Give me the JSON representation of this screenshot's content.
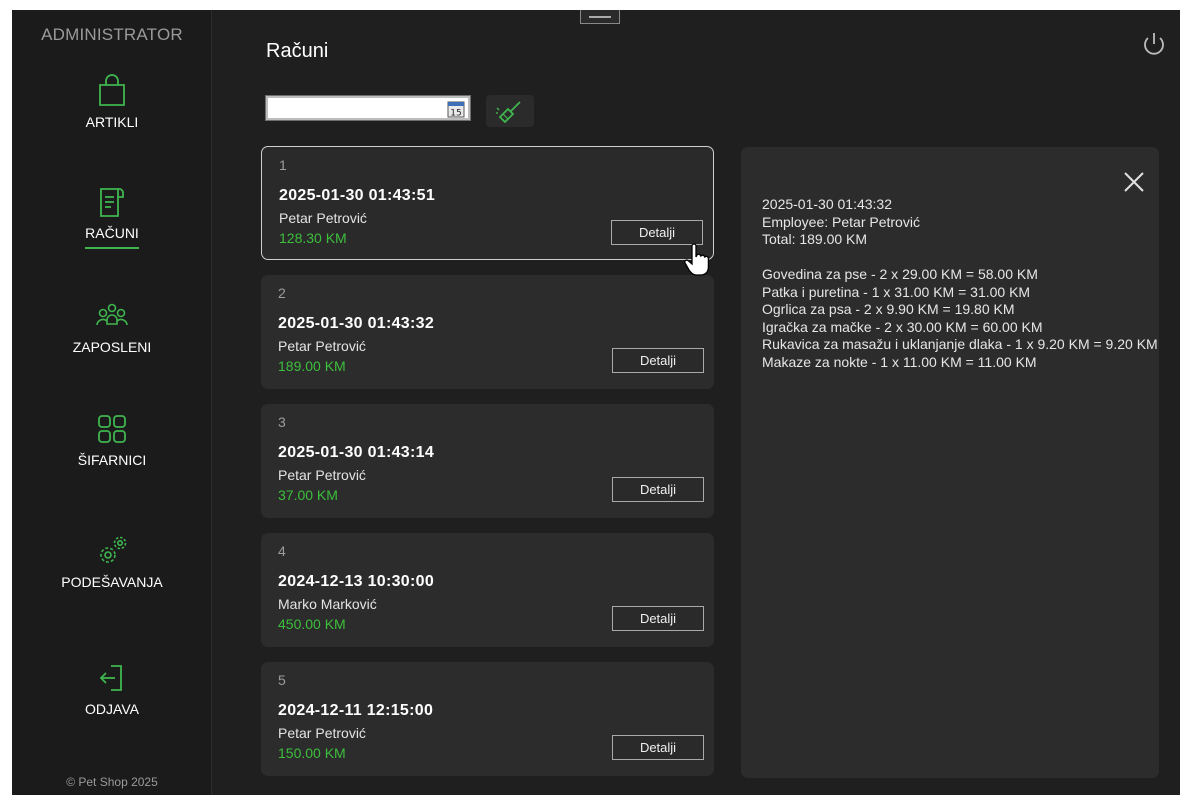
{
  "sidebar": {
    "title": "ADMINISTRATOR",
    "items": [
      {
        "label": "ARTIKLI",
        "icon": "shopping-bag-icon"
      },
      {
        "label": "RAČUNI",
        "icon": "receipt-icon"
      },
      {
        "label": "ZAPOSLENI",
        "icon": "users-icon"
      },
      {
        "label": "ŠIFARNICI",
        "icon": "grid-icon"
      },
      {
        "label": "PODEŠAVANJA",
        "icon": "gears-icon"
      },
      {
        "label": "ODJAVA",
        "icon": "logout-icon"
      }
    ],
    "active": "RAČUNI",
    "footer": "© Pet Shop 2025"
  },
  "main": {
    "title": "Računi",
    "date_filter": {
      "value": "",
      "calendar_day": "15"
    },
    "details_button": "Detalji",
    "receipts": [
      {
        "num": "1",
        "date": "2025-01-30 01:43:51",
        "employee": "Petar Petrović",
        "total": "128.30 KM"
      },
      {
        "num": "2",
        "date": "2025-01-30 01:43:32",
        "employee": "Petar Petrović",
        "total": "189.00 KM"
      },
      {
        "num": "3",
        "date": "2025-01-30 01:43:14",
        "employee": "Petar Petrović",
        "total": "37.00 KM"
      },
      {
        "num": "4",
        "date": "2024-12-13 10:30:00",
        "employee": "Marko Marković",
        "total": "450.00 KM"
      },
      {
        "num": "5",
        "date": "2024-12-11 12:15:00",
        "employee": "Petar Petrović",
        "total": "150.00 KM"
      }
    ]
  },
  "details": {
    "header": [
      "2025-01-30 01:43:32",
      "Employee: Petar Petrović",
      "Total: 189.00 KM"
    ],
    "items": [
      "Govedina za pse - 2 x 29.00 KM = 58.00 KM",
      "Patka i puretina - 1 x 31.00 KM = 31.00 KM",
      "Ogrlica za psa - 2 x 9.90 KM = 19.80 KM",
      "Igračka za mačke - 2 x 30.00 KM = 60.00 KM",
      "Rukavica za masažu i uklanjanje dlaka - 1 x 9.20 KM = 9.20 KM",
      "Makaze za nokte - 1 x 11.00 KM = 11.00 KM"
    ]
  },
  "colors": {
    "accent": "#3fb54f",
    "total": "#3cbf3c",
    "background": "#1f1f1f",
    "card": "#2c2c2c"
  }
}
